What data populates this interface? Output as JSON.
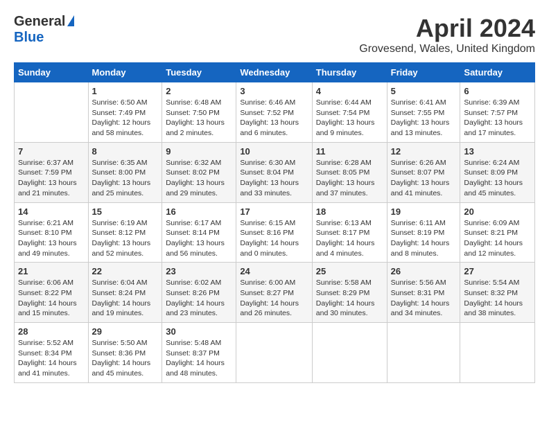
{
  "logo": {
    "general": "General",
    "blue": "Blue"
  },
  "title": "April 2024",
  "location": "Grovesend, Wales, United Kingdom",
  "days_of_week": [
    "Sunday",
    "Monday",
    "Tuesday",
    "Wednesday",
    "Thursday",
    "Friday",
    "Saturday"
  ],
  "weeks": [
    [
      {
        "day": "",
        "info": ""
      },
      {
        "day": "1",
        "info": "Sunrise: 6:50 AM\nSunset: 7:49 PM\nDaylight: 12 hours\nand 58 minutes."
      },
      {
        "day": "2",
        "info": "Sunrise: 6:48 AM\nSunset: 7:50 PM\nDaylight: 13 hours\nand 2 minutes."
      },
      {
        "day": "3",
        "info": "Sunrise: 6:46 AM\nSunset: 7:52 PM\nDaylight: 13 hours\nand 6 minutes."
      },
      {
        "day": "4",
        "info": "Sunrise: 6:44 AM\nSunset: 7:54 PM\nDaylight: 13 hours\nand 9 minutes."
      },
      {
        "day": "5",
        "info": "Sunrise: 6:41 AM\nSunset: 7:55 PM\nDaylight: 13 hours\nand 13 minutes."
      },
      {
        "day": "6",
        "info": "Sunrise: 6:39 AM\nSunset: 7:57 PM\nDaylight: 13 hours\nand 17 minutes."
      }
    ],
    [
      {
        "day": "7",
        "info": "Sunrise: 6:37 AM\nSunset: 7:59 PM\nDaylight: 13 hours\nand 21 minutes."
      },
      {
        "day": "8",
        "info": "Sunrise: 6:35 AM\nSunset: 8:00 PM\nDaylight: 13 hours\nand 25 minutes."
      },
      {
        "day": "9",
        "info": "Sunrise: 6:32 AM\nSunset: 8:02 PM\nDaylight: 13 hours\nand 29 minutes."
      },
      {
        "day": "10",
        "info": "Sunrise: 6:30 AM\nSunset: 8:04 PM\nDaylight: 13 hours\nand 33 minutes."
      },
      {
        "day": "11",
        "info": "Sunrise: 6:28 AM\nSunset: 8:05 PM\nDaylight: 13 hours\nand 37 minutes."
      },
      {
        "day": "12",
        "info": "Sunrise: 6:26 AM\nSunset: 8:07 PM\nDaylight: 13 hours\nand 41 minutes."
      },
      {
        "day": "13",
        "info": "Sunrise: 6:24 AM\nSunset: 8:09 PM\nDaylight: 13 hours\nand 45 minutes."
      }
    ],
    [
      {
        "day": "14",
        "info": "Sunrise: 6:21 AM\nSunset: 8:10 PM\nDaylight: 13 hours\nand 49 minutes."
      },
      {
        "day": "15",
        "info": "Sunrise: 6:19 AM\nSunset: 8:12 PM\nDaylight: 13 hours\nand 52 minutes."
      },
      {
        "day": "16",
        "info": "Sunrise: 6:17 AM\nSunset: 8:14 PM\nDaylight: 13 hours\nand 56 minutes."
      },
      {
        "day": "17",
        "info": "Sunrise: 6:15 AM\nSunset: 8:16 PM\nDaylight: 14 hours\nand 0 minutes."
      },
      {
        "day": "18",
        "info": "Sunrise: 6:13 AM\nSunset: 8:17 PM\nDaylight: 14 hours\nand 4 minutes."
      },
      {
        "day": "19",
        "info": "Sunrise: 6:11 AM\nSunset: 8:19 PM\nDaylight: 14 hours\nand 8 minutes."
      },
      {
        "day": "20",
        "info": "Sunrise: 6:09 AM\nSunset: 8:21 PM\nDaylight: 14 hours\nand 12 minutes."
      }
    ],
    [
      {
        "day": "21",
        "info": "Sunrise: 6:06 AM\nSunset: 8:22 PM\nDaylight: 14 hours\nand 15 minutes."
      },
      {
        "day": "22",
        "info": "Sunrise: 6:04 AM\nSunset: 8:24 PM\nDaylight: 14 hours\nand 19 minutes."
      },
      {
        "day": "23",
        "info": "Sunrise: 6:02 AM\nSunset: 8:26 PM\nDaylight: 14 hours\nand 23 minutes."
      },
      {
        "day": "24",
        "info": "Sunrise: 6:00 AM\nSunset: 8:27 PM\nDaylight: 14 hours\nand 26 minutes."
      },
      {
        "day": "25",
        "info": "Sunrise: 5:58 AM\nSunset: 8:29 PM\nDaylight: 14 hours\nand 30 minutes."
      },
      {
        "day": "26",
        "info": "Sunrise: 5:56 AM\nSunset: 8:31 PM\nDaylight: 14 hours\nand 34 minutes."
      },
      {
        "day": "27",
        "info": "Sunrise: 5:54 AM\nSunset: 8:32 PM\nDaylight: 14 hours\nand 38 minutes."
      }
    ],
    [
      {
        "day": "28",
        "info": "Sunrise: 5:52 AM\nSunset: 8:34 PM\nDaylight: 14 hours\nand 41 minutes."
      },
      {
        "day": "29",
        "info": "Sunrise: 5:50 AM\nSunset: 8:36 PM\nDaylight: 14 hours\nand 45 minutes."
      },
      {
        "day": "30",
        "info": "Sunrise: 5:48 AM\nSunset: 8:37 PM\nDaylight: 14 hours\nand 48 minutes."
      },
      {
        "day": "",
        "info": ""
      },
      {
        "day": "",
        "info": ""
      },
      {
        "day": "",
        "info": ""
      },
      {
        "day": "",
        "info": ""
      }
    ]
  ]
}
